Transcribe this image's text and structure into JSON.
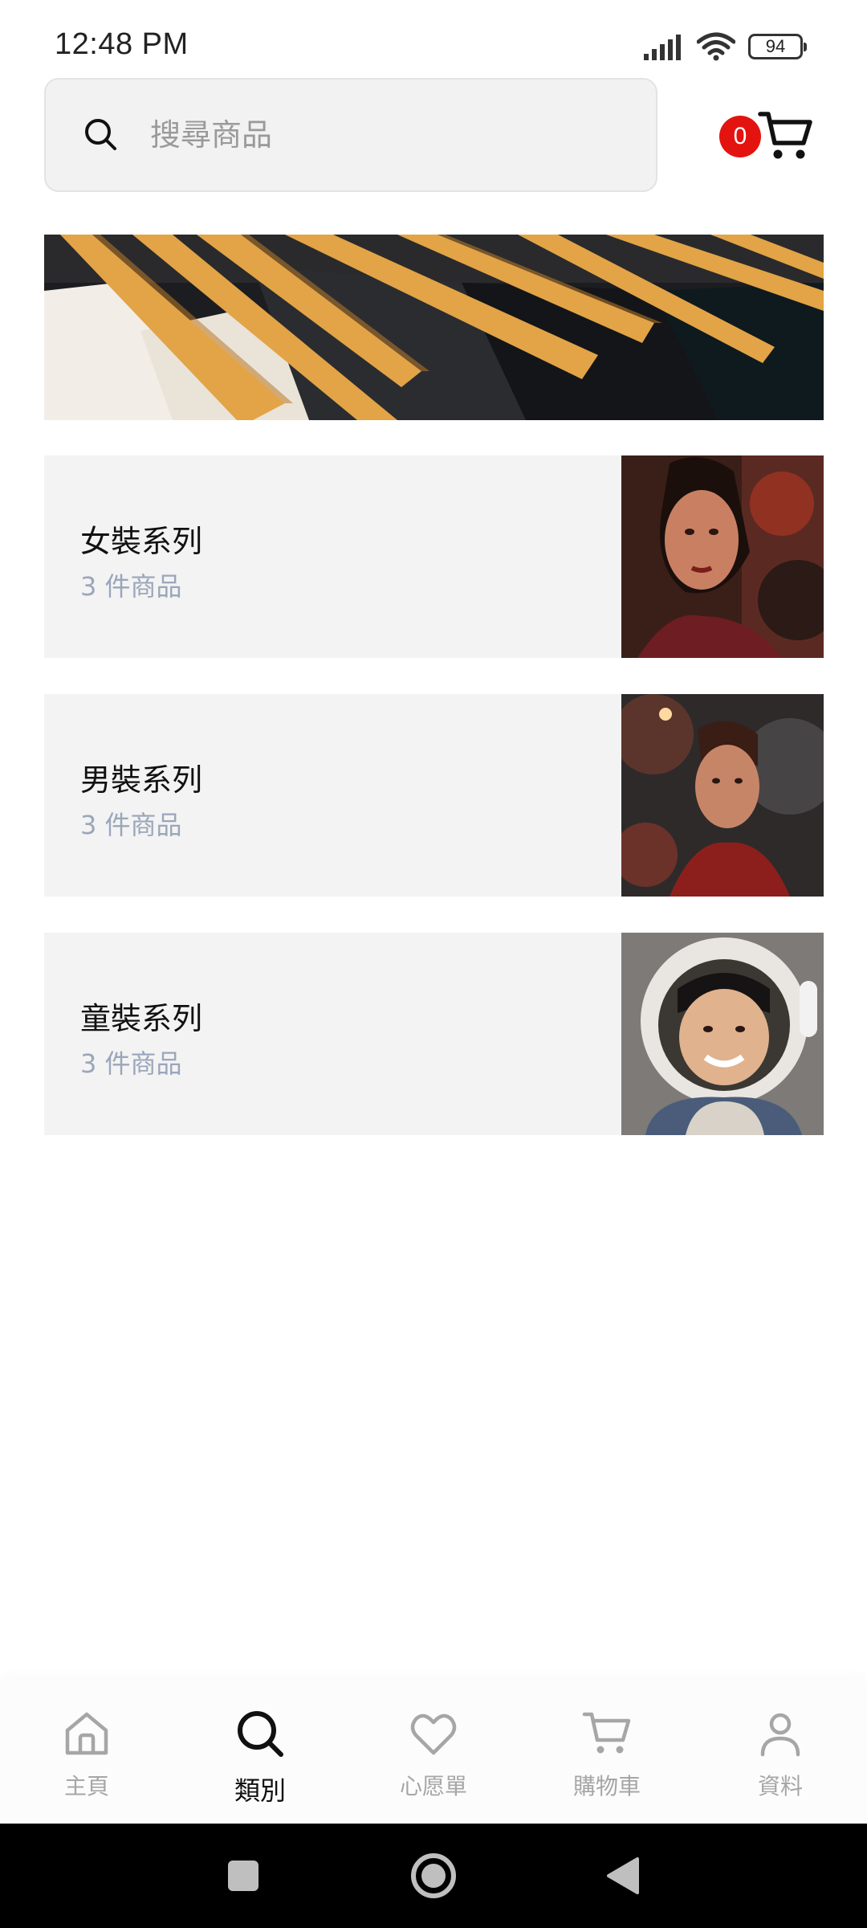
{
  "status_bar": {
    "time": "12:48 PM",
    "battery": "94"
  },
  "search": {
    "placeholder": "搜尋商品",
    "value": ""
  },
  "cart": {
    "count": "0"
  },
  "categories": [
    {
      "title": "女裝系列",
      "count": "3 件商品"
    },
    {
      "title": "男裝系列",
      "count": "3 件商品"
    },
    {
      "title": "童裝系列",
      "count": "3 件商品"
    }
  ],
  "bottom_nav": [
    {
      "label": "主頁",
      "icon": "home-icon",
      "active": false
    },
    {
      "label": "類別",
      "icon": "search-icon",
      "active": true
    },
    {
      "label": "心愿單",
      "icon": "heart-icon",
      "active": false
    },
    {
      "label": "購物車",
      "icon": "cart-icon",
      "active": false
    },
    {
      "label": "資料",
      "icon": "person-icon",
      "active": false
    }
  ],
  "colors": {
    "badge": "#e3140f",
    "card_bg": "#f3f3f3",
    "muted_text": "#9aa6ba",
    "inactive_nav": "#a6a6a6"
  }
}
